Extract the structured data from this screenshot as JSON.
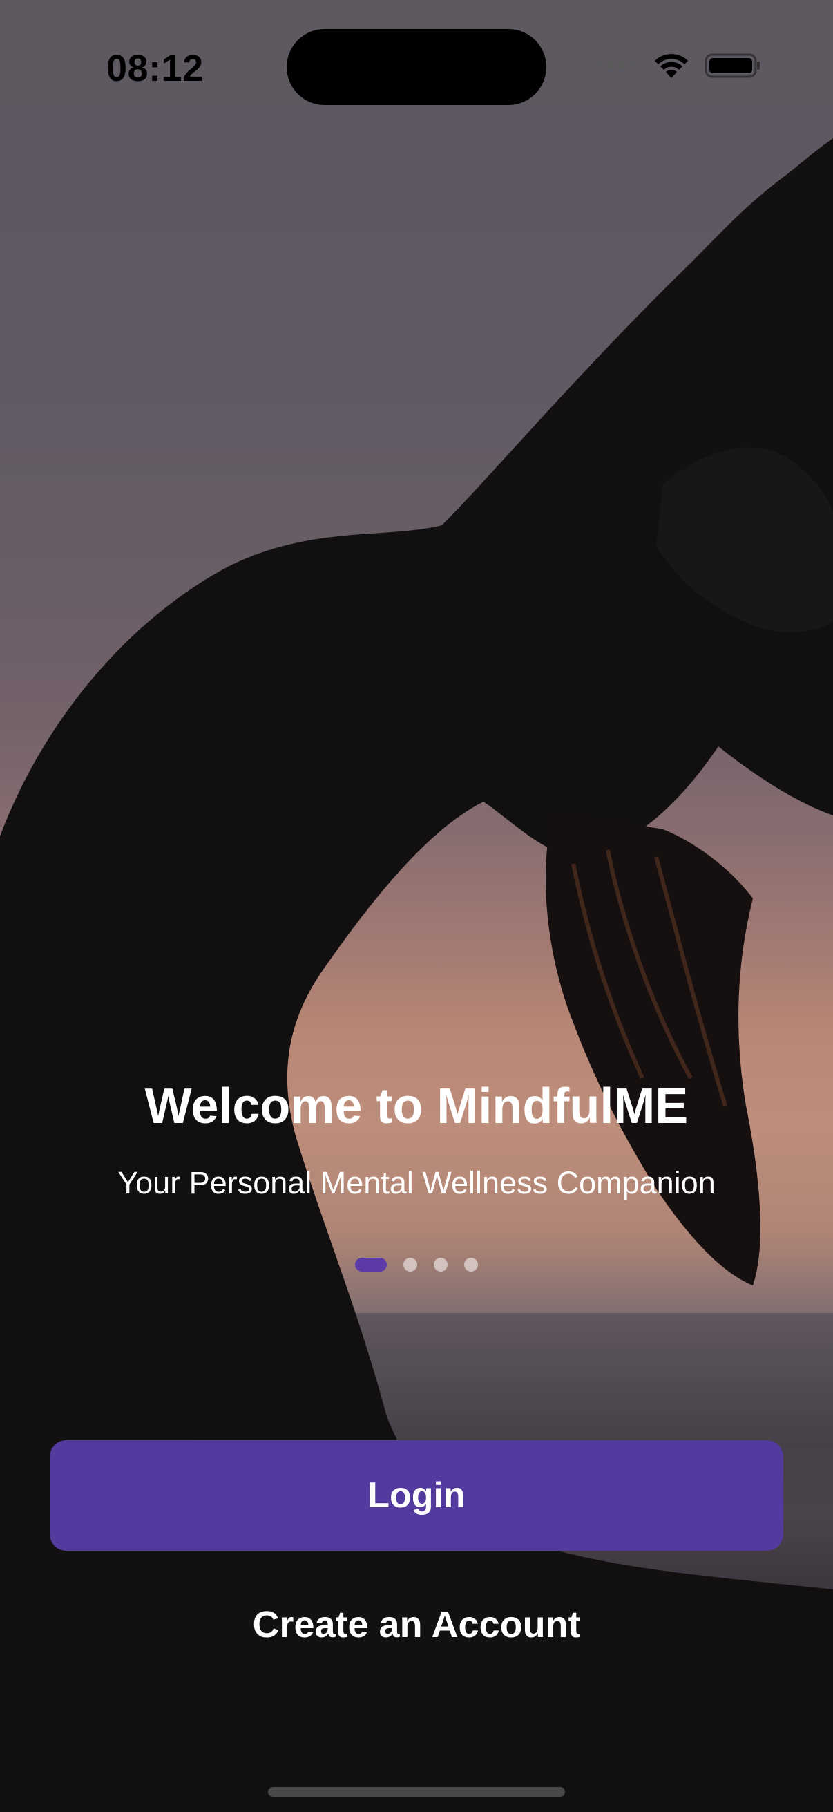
{
  "status_bar": {
    "time": "08:12",
    "signal_icon": "cellular-signal-icon",
    "wifi_icon": "wifi-icon",
    "battery_icon": "battery-icon"
  },
  "hero": {
    "background_image": "yoga-silhouette-sunset",
    "title": "Welcome to MindfulME",
    "subtitle": "Your Personal Mental Wellness Companion"
  },
  "pager": {
    "total_pages": 4,
    "active_index": 0
  },
  "actions": {
    "login_label": "Login",
    "create_account_label": "Create an Account"
  },
  "colors": {
    "accent": "#533a9e",
    "active_dot": "#5b3aa6"
  }
}
